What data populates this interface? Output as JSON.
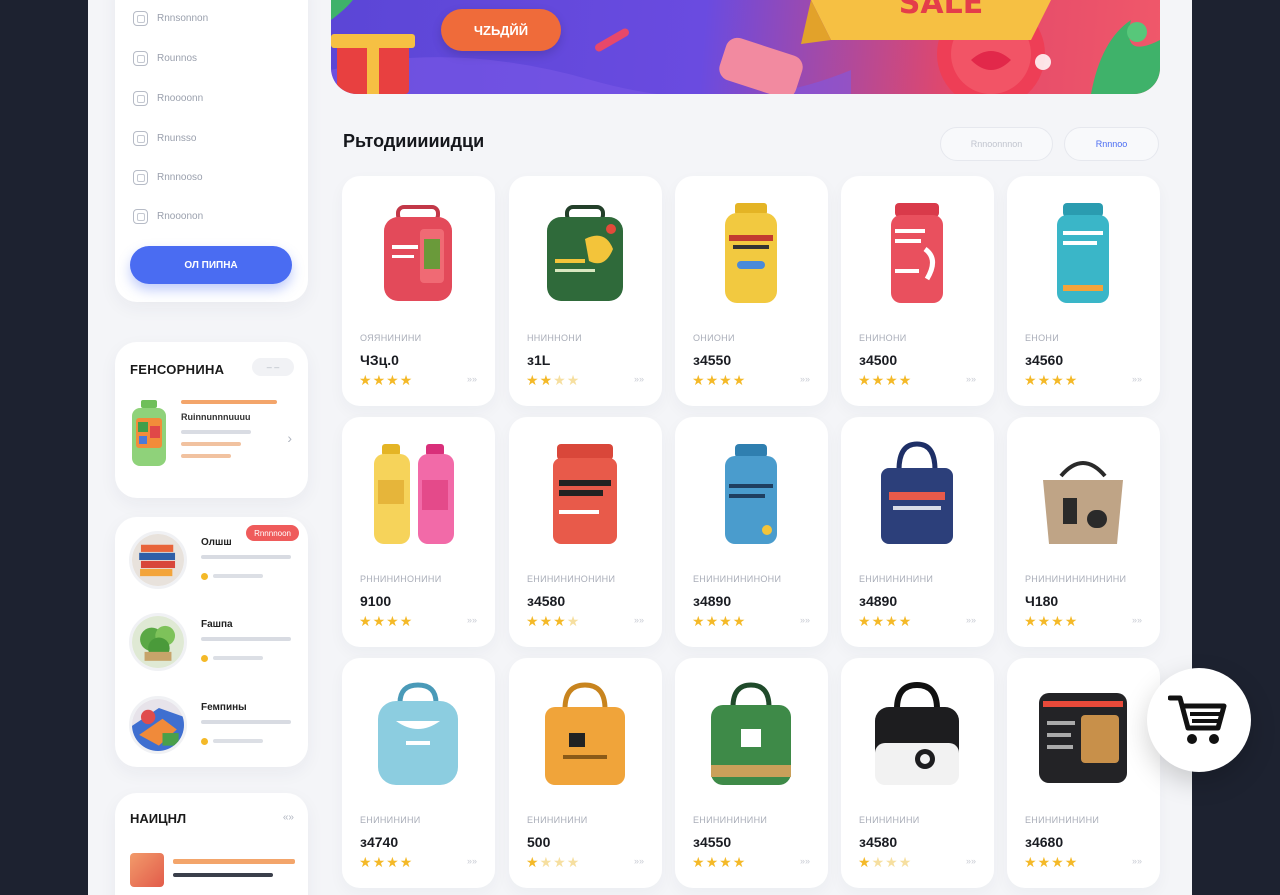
{
  "sidebar": {
    "nav_items": [
      {
        "label": "Rnnsonnon",
        "icon": "home-icon"
      },
      {
        "label": "Rounnos",
        "icon": "grid-icon"
      },
      {
        "label": "Rnoooonn",
        "icon": "bag-icon"
      },
      {
        "label": "Rnunsso",
        "icon": "edit-icon"
      },
      {
        "label": "Rnnnooso",
        "icon": "tag-icon"
      },
      {
        "label": "Rnooonon",
        "icon": "settings-icon"
      }
    ],
    "primary_button": "ОЛ ПИПНА"
  },
  "favorites": {
    "title": "FЕНСОРНИНА",
    "toggle": "– –",
    "item_title": "Ruinnunnnuuuu"
  },
  "categories": [
    {
      "name": "Олшш",
      "badge": "Rnnnnoon"
    },
    {
      "name": "Fашпа",
      "badge": ""
    },
    {
      "name": "Fемпины",
      "badge": ""
    }
  ],
  "news": {
    "title": "НАИЦНЛ",
    "toggle": "«»"
  },
  "banner": {
    "button_label": "ЧZЬДЙЙ",
    "sale_text": "SALЕ",
    "colors": {
      "start": "#5b46d6",
      "end": "#f0586a",
      "button": "#ef6b3a"
    }
  },
  "products_section": {
    "title": "Рьтодииииидци",
    "filter_label": "Rnnoonnnon",
    "active_label": "Rnnnoo"
  },
  "products": [
    {
      "name": "ОЯЯНИНИНИ",
      "price": "ЧЗц.0",
      "rating": 4,
      "icon": "red-backpack"
    },
    {
      "name": "ННИННОНИ",
      "price": "з1L",
      "rating": 2,
      "icon": "green-backpack"
    },
    {
      "name": "ОНИОНИ",
      "price": "з4550",
      "rating": 4,
      "icon": "yellow-bottle"
    },
    {
      "name": "ЕНИНОНИ",
      "price": "з4500",
      "rating": 4,
      "icon": "red-jar"
    },
    {
      "name": "ЕНОНИ",
      "price": "з4560",
      "rating": 4,
      "icon": "teal-jar"
    },
    {
      "name": "РННИНИНОНИНИ",
      "price": "9100",
      "rating": 4,
      "icon": "two-bottles"
    },
    {
      "name": "ЕНИНИНИНОНИНИ",
      "price": "з4580",
      "rating": 3,
      "icon": "red-container"
    },
    {
      "name": "ЕНИНИНИНИНОНИ",
      "price": "з4890",
      "rating": 4,
      "icon": "blue-bottle"
    },
    {
      "name": "ЕНИНИНИНИНИ",
      "price": "з4890",
      "rating": 4,
      "icon": "navy-tote"
    },
    {
      "name": "РНИНИНИНИНИНИНИ",
      "price": "Ч180",
      "rating": 4,
      "icon": "woven-basket"
    },
    {
      "name": "ЕНИНИНИНИ",
      "price": "з4740",
      "rating": 4,
      "icon": "lightblue-bag"
    },
    {
      "name": "ЕНИНИНИНИ",
      "price": "500",
      "rating": 1,
      "icon": "orange-tote"
    },
    {
      "name": "ЕНИНИНИНИНИ",
      "price": "з4550",
      "rating": 4,
      "icon": "green-bag"
    },
    {
      "name": "ЕНИНИНИНИ",
      "price": "з4580",
      "rating": 1,
      "icon": "black-bag"
    },
    {
      "name": "ЕНИНИНИНИНИ",
      "price": "з4680",
      "rating": 4,
      "icon": "dark-case"
    }
  ],
  "cart": {
    "icon": "shopping-cart-icon"
  }
}
